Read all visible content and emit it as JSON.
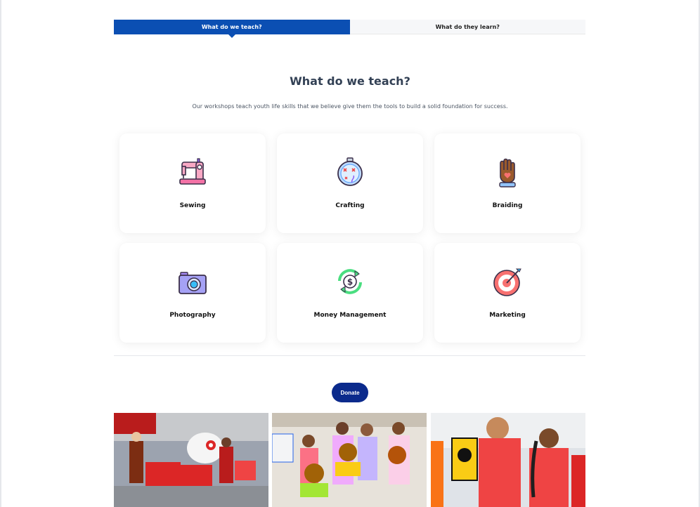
{
  "tabs": [
    {
      "label": "What do we teach?",
      "active": true
    },
    {
      "label": "What do they learn?",
      "active": false
    }
  ],
  "section": {
    "title": "What do we teach?",
    "subtitle": "Our workshops teach youth life skills that we believe give them the tools to build a solid foundation for success."
  },
  "cards": [
    {
      "label": "Sewing",
      "icon": "sewing-machine-icon"
    },
    {
      "label": "Crafting",
      "icon": "embroidery-hoop-icon"
    },
    {
      "label": "Braiding",
      "icon": "raised-hand-heart-icon"
    },
    {
      "label": "Photography",
      "icon": "camera-icon"
    },
    {
      "label": "Money Management",
      "icon": "dollar-cycle-icon"
    },
    {
      "label": "Marketing",
      "icon": "target-arrow-icon"
    }
  ],
  "donate": {
    "label": "Donate"
  },
  "photos": [
    {
      "name": "group-photo-store-mascot"
    },
    {
      "name": "children-teddy-bears-photo"
    },
    {
      "name": "volunteers-red-shirts-photo"
    }
  ],
  "colors": {
    "accent": "#0b4fb3",
    "donate": "#0b2a8c",
    "title": "#334155"
  }
}
